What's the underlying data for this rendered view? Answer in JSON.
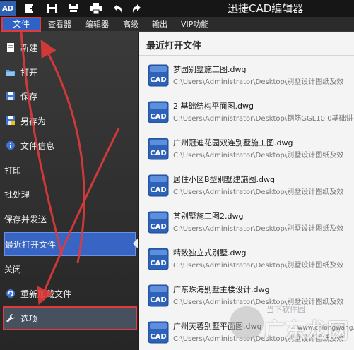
{
  "app": {
    "logo_text": "AD",
    "title": "迅捷CAD编辑器"
  },
  "quick_access": [
    {
      "icon": "new-file-icon"
    },
    {
      "icon": "save-icon"
    },
    {
      "icon": "save-pdf-icon"
    },
    {
      "icon": "print-icon"
    },
    {
      "icon": "undo-icon"
    },
    {
      "icon": "redo-icon"
    }
  ],
  "menubar": {
    "items": [
      "文件",
      "查看器",
      "编辑器",
      "高级",
      "输出",
      "VIP功能"
    ]
  },
  "sidebar": {
    "items": [
      {
        "label": "新建",
        "icon": "new-document-icon"
      },
      {
        "label": "打开",
        "icon": "open-folder-icon"
      },
      {
        "label": "保存",
        "icon": "save-icon"
      },
      {
        "label": "另存为",
        "icon": "save-as-icon"
      },
      {
        "label": "文件信息",
        "icon": "file-info-icon"
      },
      {
        "label": "打印",
        "icon": ""
      },
      {
        "label": "批处理",
        "icon": ""
      },
      {
        "label": "保存并发送",
        "icon": ""
      },
      {
        "label": "最近打开文件",
        "icon": ""
      },
      {
        "label": "关闭",
        "icon": ""
      },
      {
        "label": "重新加载文件",
        "icon": "reload-icon"
      },
      {
        "label": "选项",
        "icon": "wrench-icon"
      }
    ],
    "active_index": 8,
    "highlight_index": 11
  },
  "recent": {
    "title": "最近打开文件",
    "icon_label": "CAD",
    "files": [
      {
        "name": "梦园别墅施工图.dwg",
        "path": "C:\\Users\\Administrator\\Desktop\\别墅设计图纸及效"
      },
      {
        "name": "2 基础结构平面图.dwg",
        "path": "C:\\Users\\Administrator\\Desktop\\钢筋GGL10.0基础讲"
      },
      {
        "name": "广州冠迪花园双连别墅施工图.dwg",
        "path": "C:\\Users\\Administrator\\Desktop\\别墅设计图纸及效"
      },
      {
        "name": "居住小区B型别墅建施图.dwg",
        "path": "C:\\Users\\Administrator\\Desktop\\别墅设计图纸及效"
      },
      {
        "name": "某别墅施工图2.dwg",
        "path": "C:\\Users\\Administrator\\Desktop\\别墅设计图纸及效"
      },
      {
        "name": "精致独立式别墅.dwg",
        "path": "C:\\Users\\Administrator\\Desktop\\别墅设计图纸及效"
      },
      {
        "name": "广东珠海别墅主楼设计.dwg",
        "path": "C:\\Users\\Administrator\\Desktop\\别墅设计图纸及效"
      },
      {
        "name": "广州芙蓉别墅平面图.dwg",
        "path": "C:\\Users\\Administrator\\Desktop\\别墅设计图纸及效"
      }
    ]
  },
  "watermark": {
    "small": "当下软件园",
    "big": "广东龙网",
    "url": "www.cnlongwang.com"
  },
  "colors": {
    "accent_blue": "#2f62c7",
    "annotation_red": "#e23a3a",
    "cad_icon_blue": "#2d62b8"
  }
}
